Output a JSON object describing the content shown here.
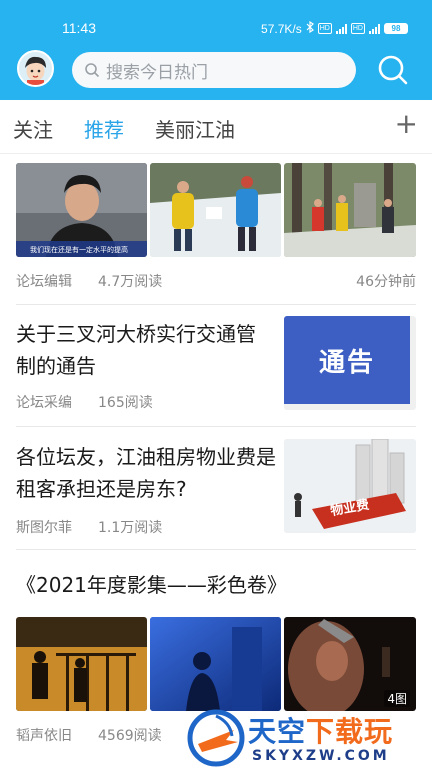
{
  "status_bar": {
    "time": "11:43",
    "net_speed": "57.7K/s",
    "battery": "98"
  },
  "header": {
    "search_placeholder": "搜索今日热门",
    "brand_color": "#26b3ef"
  },
  "tabs": [
    {
      "label": "关注",
      "active": false
    },
    {
      "label": "推荐",
      "active": true
    },
    {
      "label": "美丽江油",
      "active": false
    }
  ],
  "add_tab_label": "+",
  "feed": [
    {
      "type": "three-image",
      "images": [
        "athlete-interview-photo",
        "people-in-snow-photo",
        "forest-memorial-photo"
      ],
      "image_caption": "我们现在还是有一定水平的提高",
      "source": "论坛编辑",
      "reads": "4.7万阅读",
      "time": "46分钟前"
    },
    {
      "type": "right-image",
      "title": "关于三叉河大桥实行交通管制的通告",
      "image_text": "通告",
      "source": "论坛采编",
      "reads": "165阅读"
    },
    {
      "type": "right-image",
      "title": "各位坛友，江油租房物业费是租客承担还是房东?",
      "image_text": "物业费",
      "source": "斯图尔菲",
      "reads": "1.1万阅读"
    },
    {
      "type": "three-image",
      "title": "《2021年度影集——彩色卷》",
      "images": [
        "night-silhouettes-photo",
        "blue-shadow-photo",
        "closeup-face-photo"
      ],
      "pic_count": "4图",
      "source": "韬声依旧",
      "reads": "4569阅读"
    }
  ],
  "watermark": {
    "title_main": "天空",
    "title_accent": "下载玩",
    "subtitle": "SKYXZW.COM"
  }
}
